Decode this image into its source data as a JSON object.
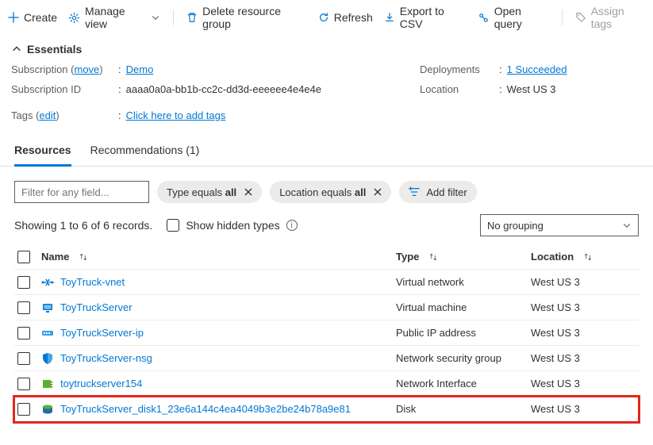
{
  "toolbar": {
    "create": "Create",
    "manage_view": "Manage view",
    "delete": "Delete resource group",
    "refresh": "Refresh",
    "export": "Export to CSV",
    "open_query": "Open query",
    "assign_tags": "Assign tags"
  },
  "essentials": {
    "title": "Essentials",
    "subscription_label": "Subscription",
    "subscription_action": "move",
    "subscription_value": "Demo",
    "subscription_id_label": "Subscription ID",
    "subscription_id_value": "aaaa0a0a-bb1b-cc2c-dd3d-eeeeee4e4e4e",
    "tags_label": "Tags",
    "tags_action": "edit",
    "tags_value": "Click here to add tags",
    "deployments_label": "Deployments",
    "deployments_value": "1 Succeeded",
    "location_label": "Location",
    "location_value": "West US 3"
  },
  "tabs": {
    "resources": "Resources",
    "recommendations": "Recommendations (1)"
  },
  "filters": {
    "placeholder": "Filter for any field...",
    "type_pill_prefix": "Type equals ",
    "type_pill_value": "all",
    "location_pill_prefix": "Location equals ",
    "location_pill_value": "all",
    "add_filter": "Add filter"
  },
  "status": {
    "records": "Showing 1 to 6 of 6 records.",
    "show_hidden": "Show hidden types",
    "grouping": "No grouping"
  },
  "columns": {
    "name": "Name",
    "type": "Type",
    "location": "Location"
  },
  "rows": [
    {
      "icon": "vnet",
      "name": "ToyTruck-vnet",
      "type": "Virtual network",
      "location": "West US 3",
      "highlight": false
    },
    {
      "icon": "vm",
      "name": "ToyTruckServer",
      "type": "Virtual machine",
      "location": "West US 3",
      "highlight": false
    },
    {
      "icon": "ip",
      "name": "ToyTruckServer-ip",
      "type": "Public IP address",
      "location": "West US 3",
      "highlight": false
    },
    {
      "icon": "nsg",
      "name": "ToyTruckServer-nsg",
      "type": "Network security group",
      "location": "West US 3",
      "highlight": false
    },
    {
      "icon": "nic",
      "name": "toytruckserver154",
      "type": "Network Interface",
      "location": "West US 3",
      "highlight": false
    },
    {
      "icon": "disk",
      "name": "ToyTruckServer_disk1_23e6a144c4ea4049b3e2be24b78a9e81",
      "type": "Disk",
      "location": "West US 3",
      "highlight": true
    }
  ]
}
